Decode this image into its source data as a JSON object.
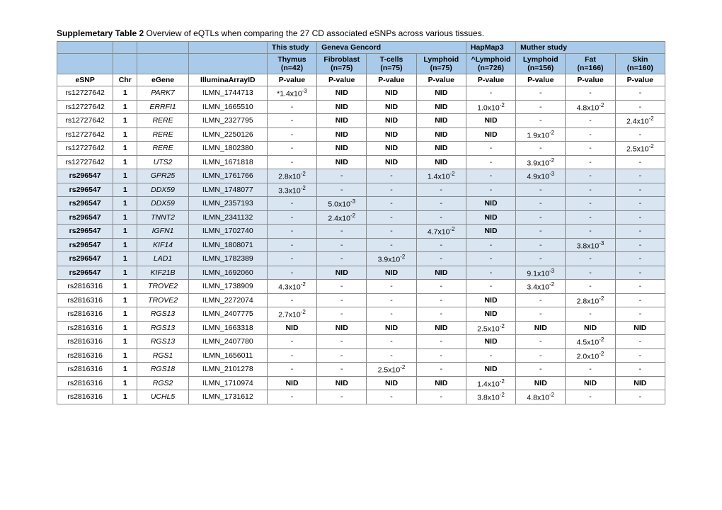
{
  "caption_bold": "Supplemetary Table 2",
  "caption_rest": " Overview of eQTLs when comparing the 27 CD associated eSNPs across various tissues.",
  "study_groups": {
    "c4": "This study",
    "c5": "Geneva Gencord",
    "c8": "HapMap3",
    "c9": "Muther study"
  },
  "tissue_row": {
    "c4a": "Thymus",
    "c4b": "(n=42)",
    "c5a": "Fibroblast",
    "c5b": "(n=75)",
    "c6a": "T-cells",
    "c6b": "(n=75)",
    "c7a": "Lymphoid",
    "c7b": "(n=75)",
    "c8a": "^Lymphoid",
    "c8b": "(n=726)",
    "c9a": "Lymphoid",
    "c9b": "(n=156)",
    "c10a": "Fat",
    "c10b": "(n=166)",
    "c11a": "Skin",
    "c11b": "(n=160)"
  },
  "col_headers": {
    "c0": "eSNP",
    "c1": "Chr",
    "c2": "eGene",
    "c3": "IlluminaArrayID",
    "c4": "P-value",
    "c5": "P-value",
    "c6": "P-value",
    "c7": "P-value",
    "c8": "P-value",
    "c9": "P-value",
    "c10": "P-value",
    "c11": "P-value"
  },
  "rows": [
    {
      "shade": false,
      "snp": "rs12727642",
      "chr": "1",
      "gene": "PARK7",
      "ill": "ILMN_1744713",
      "v": [
        "*1.4x10⁻³",
        "NID",
        "NID",
        "NID",
        "-",
        "-",
        "-",
        "-"
      ]
    },
    {
      "shade": false,
      "snp": "rs12727642",
      "chr": "1",
      "gene": "ERRFI1",
      "ill": "ILMN_1665510",
      "v": [
        "-",
        "NID",
        "NID",
        "NID",
        "1.0x10⁻²",
        "-",
        "4.8x10⁻²",
        "-"
      ]
    },
    {
      "shade": false,
      "snp": "rs12727642",
      "chr": "1",
      "gene": "RERE",
      "ill": "ILMN_2327795",
      "v": [
        "-",
        "NID",
        "NID",
        "NID",
        "NID",
        "-",
        "-",
        "2.4x10⁻²"
      ]
    },
    {
      "shade": false,
      "snp": "rs12727642",
      "chr": "1",
      "gene": "RERE",
      "ill": "ILMN_2250126",
      "v": [
        "-",
        "NID",
        "NID",
        "NID",
        "NID",
        "1.9x10⁻²",
        "-",
        "-"
      ]
    },
    {
      "shade": false,
      "snp": "rs12727642",
      "chr": "1",
      "gene": "RERE",
      "ill": "ILMN_1802380",
      "v": [
        "-",
        "NID",
        "NID",
        "NID",
        "-",
        "-",
        "-",
        "2.5x10⁻²"
      ]
    },
    {
      "shade": false,
      "snp": "rs12727642",
      "chr": "1",
      "gene": "UTS2",
      "ill": "ILMN_1671818",
      "v": [
        "-",
        "NID",
        "NID",
        "NID",
        "-",
        "3.9x10⁻²",
        "-",
        "-"
      ]
    },
    {
      "shade": true,
      "snp": "rs296547",
      "chr": "1",
      "gene": "GPR25",
      "ill": "ILMN_1761766",
      "v": [
        "2.8x10⁻²",
        "-",
        "-",
        "1.4x10⁻²",
        "-",
        "4.9x10⁻³",
        "-",
        "-"
      ]
    },
    {
      "shade": true,
      "snp": "rs296547",
      "chr": "1",
      "gene": "DDX59",
      "ill": "ILMN_1748077",
      "v": [
        "3.3x10⁻²",
        "-",
        "-",
        "-",
        "-",
        "-",
        "-",
        "-"
      ]
    },
    {
      "shade": true,
      "snp": "rs296547",
      "chr": "1",
      "gene": "DDX59",
      "ill": "ILMN_2357193",
      "v": [
        "-",
        "5.0x10⁻³",
        "-",
        "-",
        "NID",
        "-",
        "-",
        "-"
      ]
    },
    {
      "shade": true,
      "snp": "rs296547",
      "chr": "1",
      "gene": "TNNT2",
      "ill": "ILMN_2341132",
      "v": [
        "-",
        "2.4x10⁻²",
        "-",
        "-",
        "NID",
        "-",
        "-",
        "-"
      ]
    },
    {
      "shade": true,
      "snp": "rs296547",
      "chr": "1",
      "gene": "IGFN1",
      "ill": "ILMN_1702740",
      "v": [
        "-",
        "-",
        "-",
        "4.7x10⁻²",
        "NID",
        "-",
        "-",
        "-"
      ]
    },
    {
      "shade": true,
      "snp": "rs296547",
      "chr": "1",
      "gene": "KIF14",
      "ill": "ILMN_1808071",
      "v": [
        "-",
        "-",
        "-",
        "-",
        "-",
        "-",
        "3.8x10⁻³",
        "-"
      ]
    },
    {
      "shade": true,
      "snp": "rs296547",
      "chr": "1",
      "gene": "LAD1",
      "ill": "ILMN_1782389",
      "v": [
        "-",
        "-",
        "3.9x10⁻²",
        "-",
        "-",
        "-",
        "-",
        "-"
      ]
    },
    {
      "shade": true,
      "snp": "rs296547",
      "chr": "1",
      "gene": "KIF21B",
      "ill": "ILMN_1692060",
      "v": [
        "-",
        "NID",
        "NID",
        "NID",
        "-",
        "9.1x10⁻³",
        "-",
        "-"
      ]
    },
    {
      "shade": false,
      "snp": "rs2816316",
      "chr": "1",
      "gene": "TROVE2",
      "ill": "ILMN_1738909",
      "v": [
        "4.3x10⁻²",
        "-",
        "-",
        "-",
        "-",
        "3.4x10⁻²",
        "-",
        "-"
      ]
    },
    {
      "shade": false,
      "snp": "rs2816316",
      "chr": "1",
      "gene": "TROVE2",
      "ill": "ILMN_2272074",
      "v": [
        "-",
        "-",
        "-",
        "-",
        "NID",
        "-",
        "2.8x10⁻²",
        "-"
      ]
    },
    {
      "shade": false,
      "snp": "rs2816316",
      "chr": "1",
      "gene": "RGS13",
      "ill": "ILMN_2407775",
      "v": [
        "2.7x10⁻²",
        "-",
        "-",
        "-",
        "NID",
        "-",
        "-",
        "-"
      ]
    },
    {
      "shade": false,
      "snp": "rs2816316",
      "chr": "1",
      "gene": "RGS13",
      "ill": "ILMN_1663318",
      "v": [
        "NID",
        "NID",
        "NID",
        "NID",
        "2.5x10⁻²",
        "NID",
        "NID",
        "NID"
      ]
    },
    {
      "shade": false,
      "snp": "rs2816316",
      "chr": "1",
      "gene": "RGS13",
      "ill": "ILMN_2407780",
      "v": [
        "-",
        "-",
        "-",
        "-",
        "NID",
        "-",
        "4.5x10⁻²",
        "-"
      ]
    },
    {
      "shade": false,
      "snp": "rs2816316",
      "chr": "1",
      "gene": "RGS1",
      "ill": "ILMN_1656011",
      "v": [
        "-",
        "-",
        "-",
        "-",
        "-",
        "-",
        "2.0x10⁻²",
        "-"
      ]
    },
    {
      "shade": false,
      "snp": "rs2816316",
      "chr": "1",
      "gene": "RGS18",
      "ill": "ILMN_2101278",
      "v": [
        "-",
        "-",
        "2.5x10⁻²",
        "-",
        "NID",
        "-",
        "-",
        "-"
      ]
    },
    {
      "shade": false,
      "snp": "rs2816316",
      "chr": "1",
      "gene": "RGS2",
      "ill": "ILMN_1710974",
      "v": [
        "NID",
        "NID",
        "NID",
        "NID",
        "1.4x10⁻²",
        "NID",
        "NID",
        "NID"
      ]
    },
    {
      "shade": false,
      "snp": "rs2816316",
      "chr": "1",
      "gene": "UCHL5",
      "ill": "ILMN_1731612",
      "v": [
        "-",
        "-",
        "-",
        "-",
        "3.8x10⁻²",
        "4.8x10⁻²",
        "-",
        "-"
      ]
    }
  ]
}
